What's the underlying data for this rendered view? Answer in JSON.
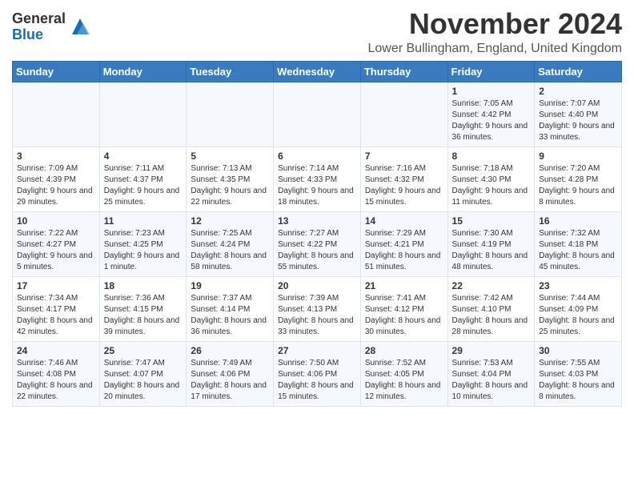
{
  "logo": {
    "general": "General",
    "blue": "Blue"
  },
  "title": "November 2024",
  "location": "Lower Bullingham, England, United Kingdom",
  "days_of_week": [
    "Sunday",
    "Monday",
    "Tuesday",
    "Wednesday",
    "Thursday",
    "Friday",
    "Saturday"
  ],
  "weeks": [
    [
      {
        "day": "",
        "info": ""
      },
      {
        "day": "",
        "info": ""
      },
      {
        "day": "",
        "info": ""
      },
      {
        "day": "",
        "info": ""
      },
      {
        "day": "",
        "info": ""
      },
      {
        "day": "1",
        "info": "Sunrise: 7:05 AM\nSunset: 4:42 PM\nDaylight: 9 hours and 36 minutes."
      },
      {
        "day": "2",
        "info": "Sunrise: 7:07 AM\nSunset: 4:40 PM\nDaylight: 9 hours and 33 minutes."
      }
    ],
    [
      {
        "day": "3",
        "info": "Sunrise: 7:09 AM\nSunset: 4:39 PM\nDaylight: 9 hours and 29 minutes."
      },
      {
        "day": "4",
        "info": "Sunrise: 7:11 AM\nSunset: 4:37 PM\nDaylight: 9 hours and 25 minutes."
      },
      {
        "day": "5",
        "info": "Sunrise: 7:13 AM\nSunset: 4:35 PM\nDaylight: 9 hours and 22 minutes."
      },
      {
        "day": "6",
        "info": "Sunrise: 7:14 AM\nSunset: 4:33 PM\nDaylight: 9 hours and 18 minutes."
      },
      {
        "day": "7",
        "info": "Sunrise: 7:16 AM\nSunset: 4:32 PM\nDaylight: 9 hours and 15 minutes."
      },
      {
        "day": "8",
        "info": "Sunrise: 7:18 AM\nSunset: 4:30 PM\nDaylight: 9 hours and 11 minutes."
      },
      {
        "day": "9",
        "info": "Sunrise: 7:20 AM\nSunset: 4:28 PM\nDaylight: 9 hours and 8 minutes."
      }
    ],
    [
      {
        "day": "10",
        "info": "Sunrise: 7:22 AM\nSunset: 4:27 PM\nDaylight: 9 hours and 5 minutes."
      },
      {
        "day": "11",
        "info": "Sunrise: 7:23 AM\nSunset: 4:25 PM\nDaylight: 9 hours and 1 minute."
      },
      {
        "day": "12",
        "info": "Sunrise: 7:25 AM\nSunset: 4:24 PM\nDaylight: 8 hours and 58 minutes."
      },
      {
        "day": "13",
        "info": "Sunrise: 7:27 AM\nSunset: 4:22 PM\nDaylight: 8 hours and 55 minutes."
      },
      {
        "day": "14",
        "info": "Sunrise: 7:29 AM\nSunset: 4:21 PM\nDaylight: 8 hours and 51 minutes."
      },
      {
        "day": "15",
        "info": "Sunrise: 7:30 AM\nSunset: 4:19 PM\nDaylight: 8 hours and 48 minutes."
      },
      {
        "day": "16",
        "info": "Sunrise: 7:32 AM\nSunset: 4:18 PM\nDaylight: 8 hours and 45 minutes."
      }
    ],
    [
      {
        "day": "17",
        "info": "Sunrise: 7:34 AM\nSunset: 4:17 PM\nDaylight: 8 hours and 42 minutes."
      },
      {
        "day": "18",
        "info": "Sunrise: 7:36 AM\nSunset: 4:15 PM\nDaylight: 8 hours and 39 minutes."
      },
      {
        "day": "19",
        "info": "Sunrise: 7:37 AM\nSunset: 4:14 PM\nDaylight: 8 hours and 36 minutes."
      },
      {
        "day": "20",
        "info": "Sunrise: 7:39 AM\nSunset: 4:13 PM\nDaylight: 8 hours and 33 minutes."
      },
      {
        "day": "21",
        "info": "Sunrise: 7:41 AM\nSunset: 4:12 PM\nDaylight: 8 hours and 30 minutes."
      },
      {
        "day": "22",
        "info": "Sunrise: 7:42 AM\nSunset: 4:10 PM\nDaylight: 8 hours and 28 minutes."
      },
      {
        "day": "23",
        "info": "Sunrise: 7:44 AM\nSunset: 4:09 PM\nDaylight: 8 hours and 25 minutes."
      }
    ],
    [
      {
        "day": "24",
        "info": "Sunrise: 7:46 AM\nSunset: 4:08 PM\nDaylight: 8 hours and 22 minutes."
      },
      {
        "day": "25",
        "info": "Sunrise: 7:47 AM\nSunset: 4:07 PM\nDaylight: 8 hours and 20 minutes."
      },
      {
        "day": "26",
        "info": "Sunrise: 7:49 AM\nSunset: 4:06 PM\nDaylight: 8 hours and 17 minutes."
      },
      {
        "day": "27",
        "info": "Sunrise: 7:50 AM\nSunset: 4:06 PM\nDaylight: 8 hours and 15 minutes."
      },
      {
        "day": "28",
        "info": "Sunrise: 7:52 AM\nSunset: 4:05 PM\nDaylight: 8 hours and 12 minutes."
      },
      {
        "day": "29",
        "info": "Sunrise: 7:53 AM\nSunset: 4:04 PM\nDaylight: 8 hours and 10 minutes."
      },
      {
        "day": "30",
        "info": "Sunrise: 7:55 AM\nSunset: 4:03 PM\nDaylight: 8 hours and 8 minutes."
      }
    ]
  ]
}
